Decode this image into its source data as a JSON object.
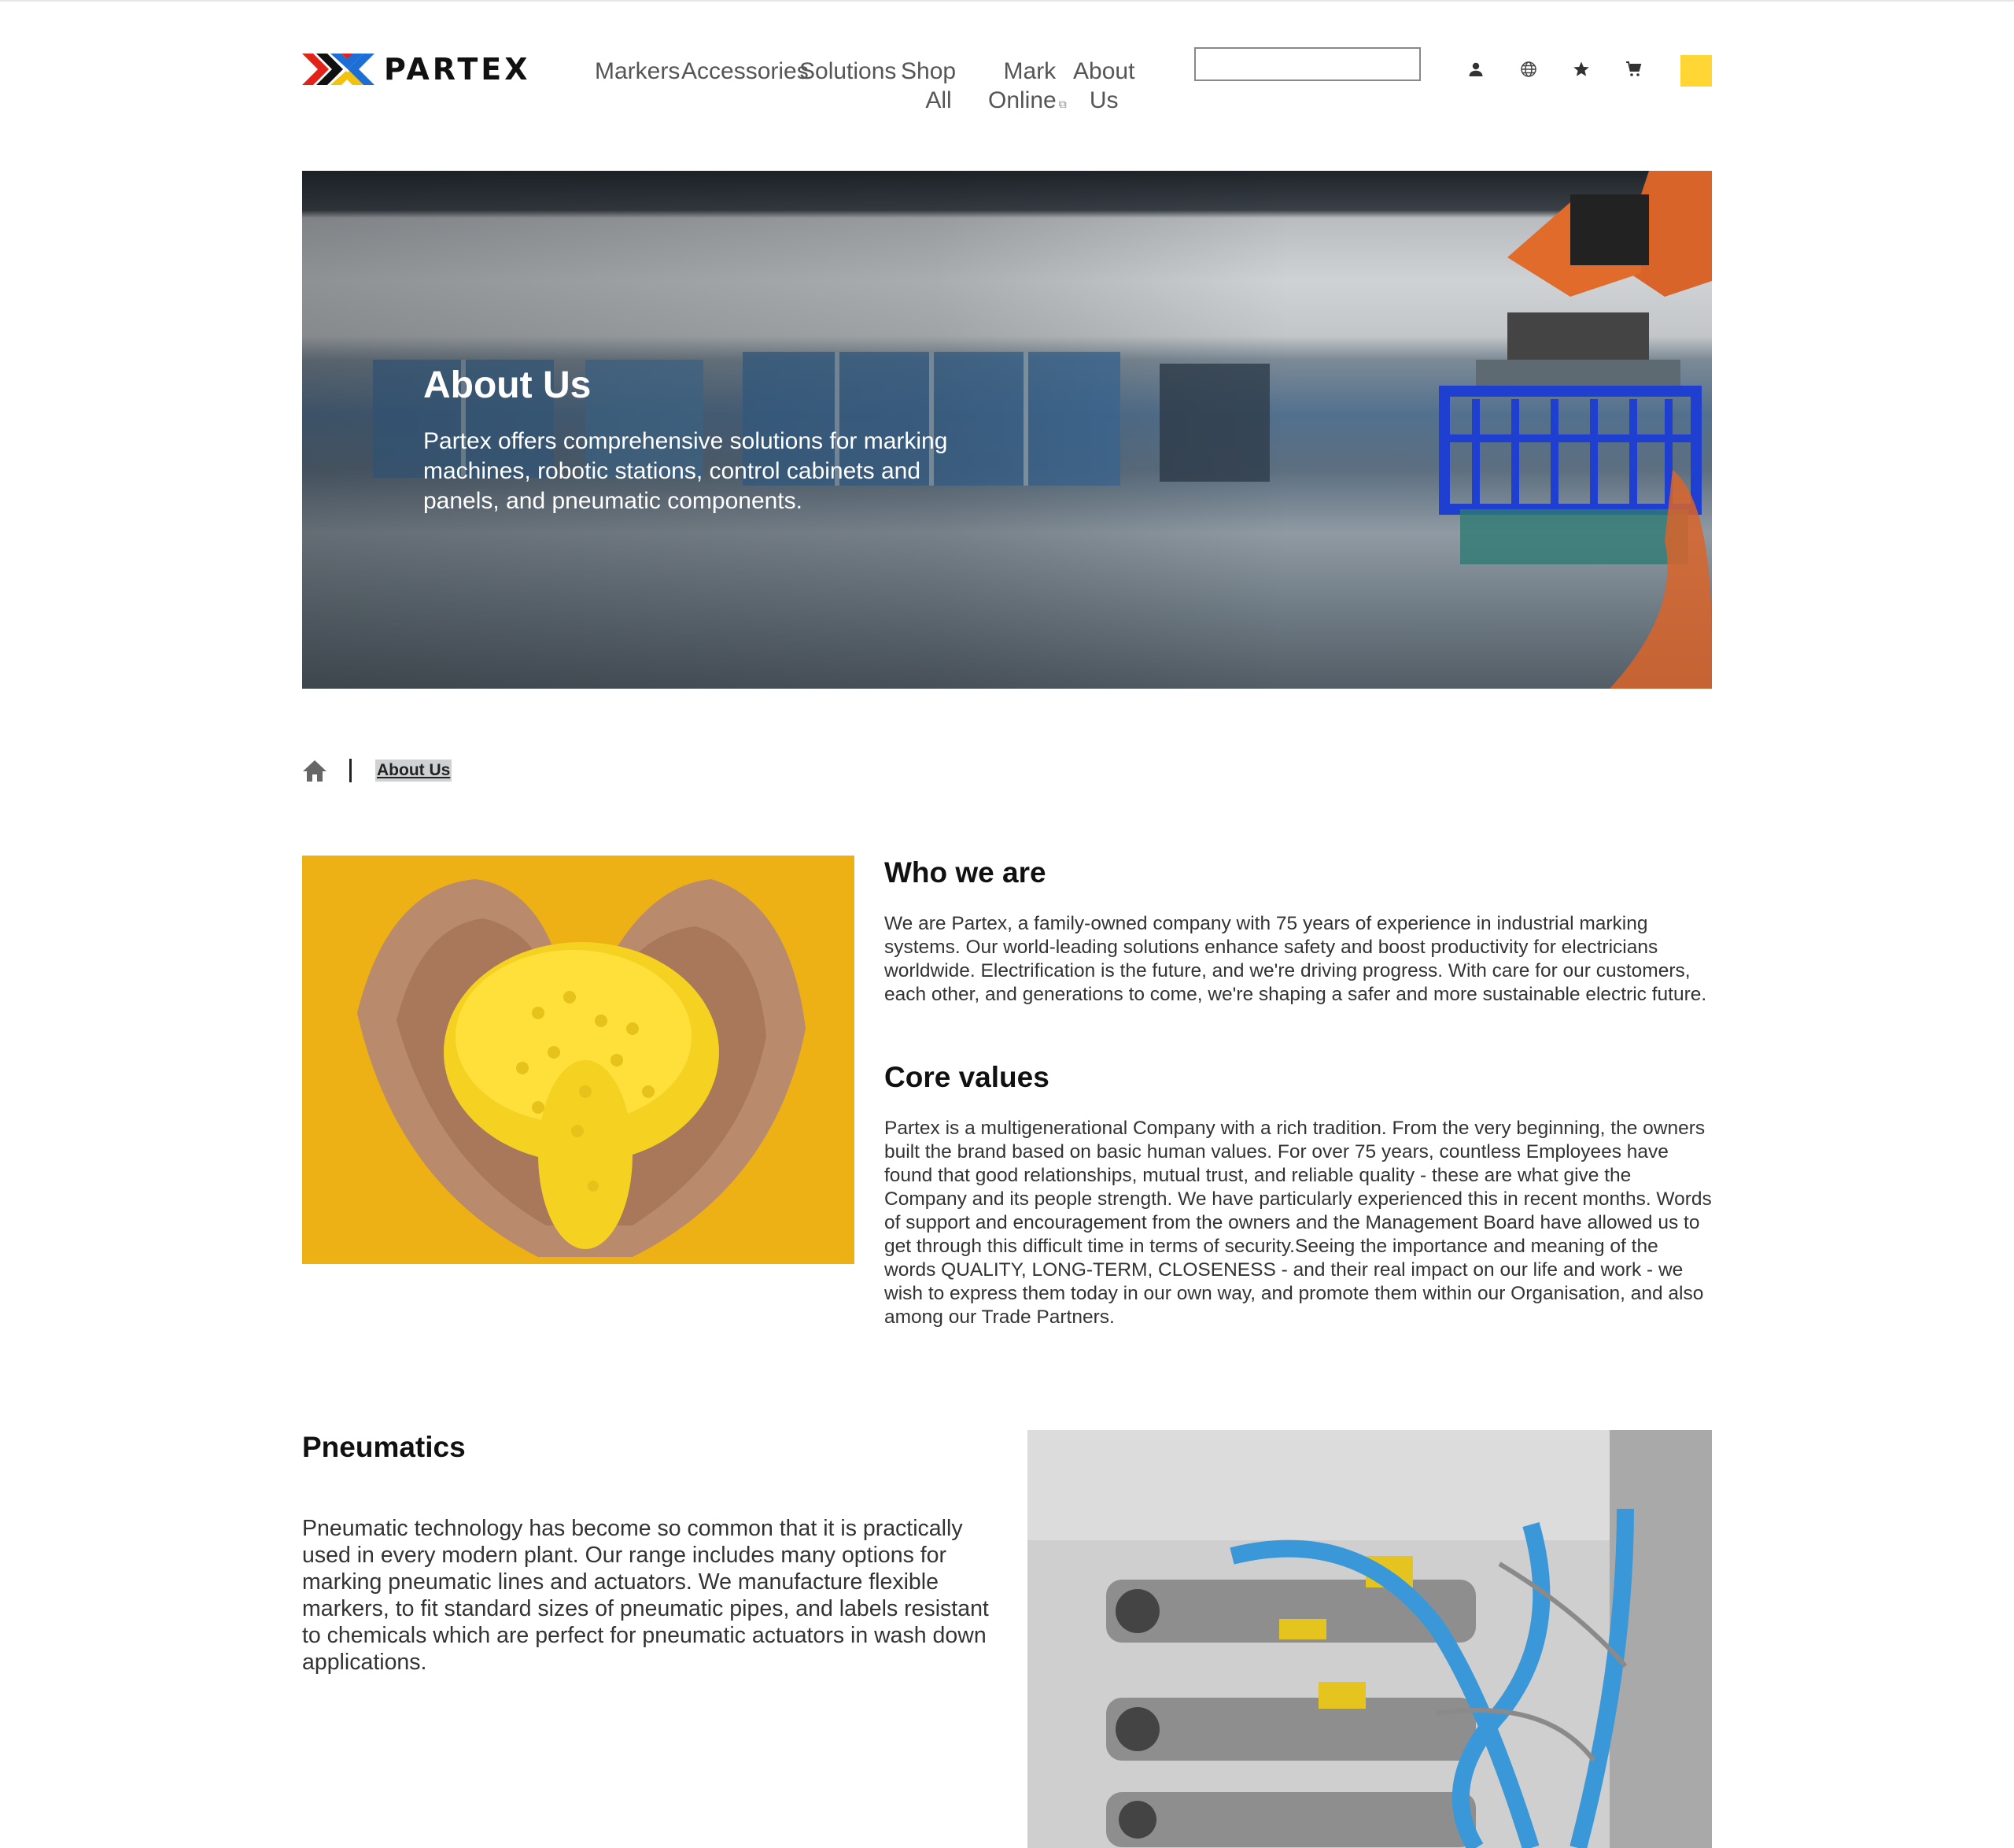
{
  "header": {
    "logo_text": "PARTEX",
    "nav": [
      {
        "label": "Markers"
      },
      {
        "label": "Accessories"
      },
      {
        "label": "Solutions"
      },
      {
        "line1": "Shop",
        "line2": "All"
      },
      {
        "line1": "Mark",
        "line2": "Online",
        "external_icon": "external-link-icon"
      },
      {
        "line1": "About",
        "line2": "Us"
      }
    ],
    "search": {
      "value": "",
      "placeholder": ""
    },
    "icons": [
      "user-icon",
      "globe-icon",
      "star-icon",
      "cart-icon"
    ],
    "accent_color": "#ffd633"
  },
  "hero": {
    "title": "About Us",
    "text": "Partex offers comprehensive solutions for marking machines, robotic stations, control cabinets and panels, and pneumatic components."
  },
  "breadcrumb": {
    "home_icon": "home-icon",
    "current": "About Us"
  },
  "who_we_are": {
    "title": "Who we are",
    "text": "We are Partex, a family-owned company with 75 years of experience in industrial marking systems. Our world-leading solutions enhance safety and boost productivity for electricians worldwide. Electrification is the future, and we're driving progress. With care for our customers, each other, and generations to come, we're shaping a safer and more sustainable electric future."
  },
  "core_values": {
    "title": "Core values",
    "text": "Partex is a multigenerational Company with a rich tradition. From the very beginning, the owners built the brand based on basic human values. For over 75 years, countless Employees have found that good relationships, mutual trust, and reliable quality - these are what give the Company and its people strength. We have particularly experienced this in recent months. Words of support and encouragement from the owners and the Management Board have allowed us to get through this difficult time in terms of security.Seeing the importance and meaning of the words QUALITY, LONG-TERM, CLOSENESS - and their real impact on our life and work - we wish to express them today in our own way, and promote them within our Organisation, and also among our Trade Partners."
  },
  "pneumatics": {
    "title": "Pneumatics",
    "text": "Pneumatic technology has become so common that it is practically used in every modern plant. Our range includes many options for marking pneumatic lines and actuators. We manufacture flexible markers, to fit standard sizes of pneumatic pipes, and labels resistant to chemicals which are perfect for pneumatic actuators in wash down applications."
  }
}
